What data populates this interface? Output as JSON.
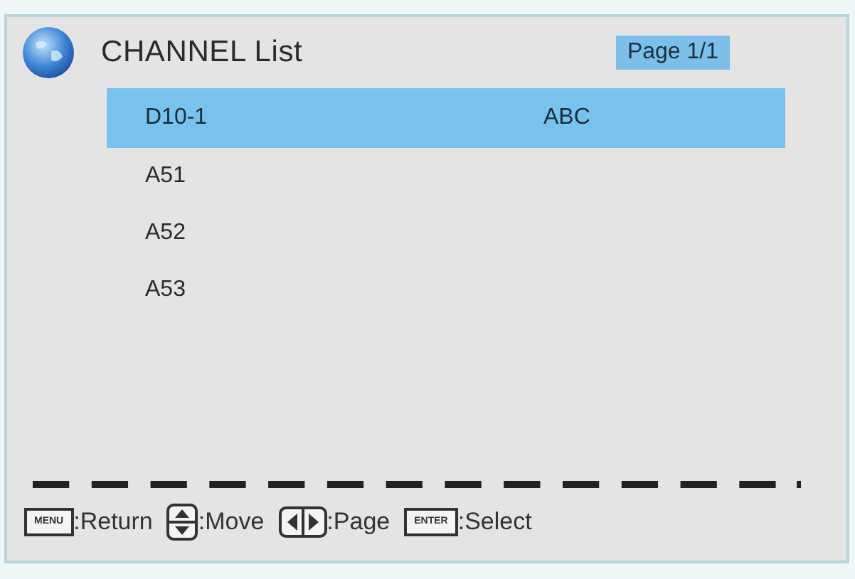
{
  "header": {
    "title": "CHANNEL List",
    "page": "Page 1/1"
  },
  "channels": [
    {
      "name": "D10-1",
      "type": "ABC",
      "selected": true
    },
    {
      "name": "A51",
      "selected": false
    },
    {
      "name": "A52",
      "selected": false
    },
    {
      "name": "A53",
      "selected": false
    }
  ],
  "hints": [
    {
      "kind": "text",
      "key": "MENU",
      "label": ":Return"
    },
    {
      "kind": "updown",
      "label": ":Move"
    },
    {
      "kind": "leftright",
      "label": ":Page"
    },
    {
      "kind": "text",
      "key": "ENTER",
      "label": ":Select"
    }
  ]
}
